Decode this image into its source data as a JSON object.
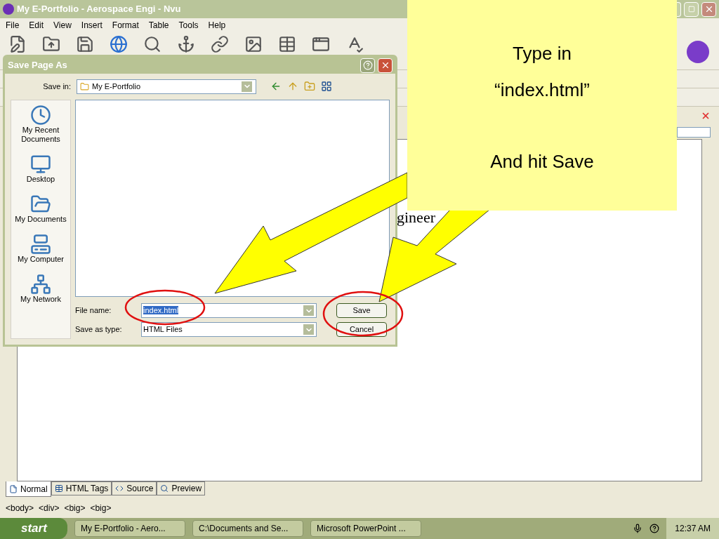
{
  "window": {
    "title": "My E-Portfolio - Aerospace Engi - Nvu"
  },
  "menu": [
    "File",
    "Edit",
    "View",
    "Insert",
    "Format",
    "Table",
    "Tools",
    "Help"
  ],
  "editor": {
    "text_fragment": "gineer"
  },
  "dialog": {
    "title": "Save Page As",
    "save_in_label": "Save in:",
    "save_in_value": "My E-Portfolio",
    "places": [
      "My Recent Documents",
      "Desktop",
      "My Documents",
      "My Computer",
      "My Network"
    ],
    "file_name_label": "File name:",
    "file_name_value": "index.html",
    "save_as_type_label": "Save as type:",
    "save_as_type_value": "HTML Files",
    "buttons": [
      "Save",
      "Cancel"
    ]
  },
  "view_tabs": [
    {
      "label": "Normal",
      "selected": true
    },
    {
      "label": "HTML Tags",
      "selected": false
    },
    {
      "label": "Source",
      "selected": false
    },
    {
      "label": "Preview",
      "selected": false
    }
  ],
  "status_bar": {
    "tags": [
      "<body>",
      "<div>",
      "<big>",
      "<big>"
    ]
  },
  "taskbar": {
    "start": "start",
    "tasks": [
      "My E-Portfolio - Aero...",
      "C:\\Documents and Se...",
      "Microsoft PowerPoint ..."
    ],
    "clock": "12:37 AM"
  },
  "note": {
    "lines": [
      "Type in",
      "“index.html”",
      "And hit Save"
    ]
  }
}
